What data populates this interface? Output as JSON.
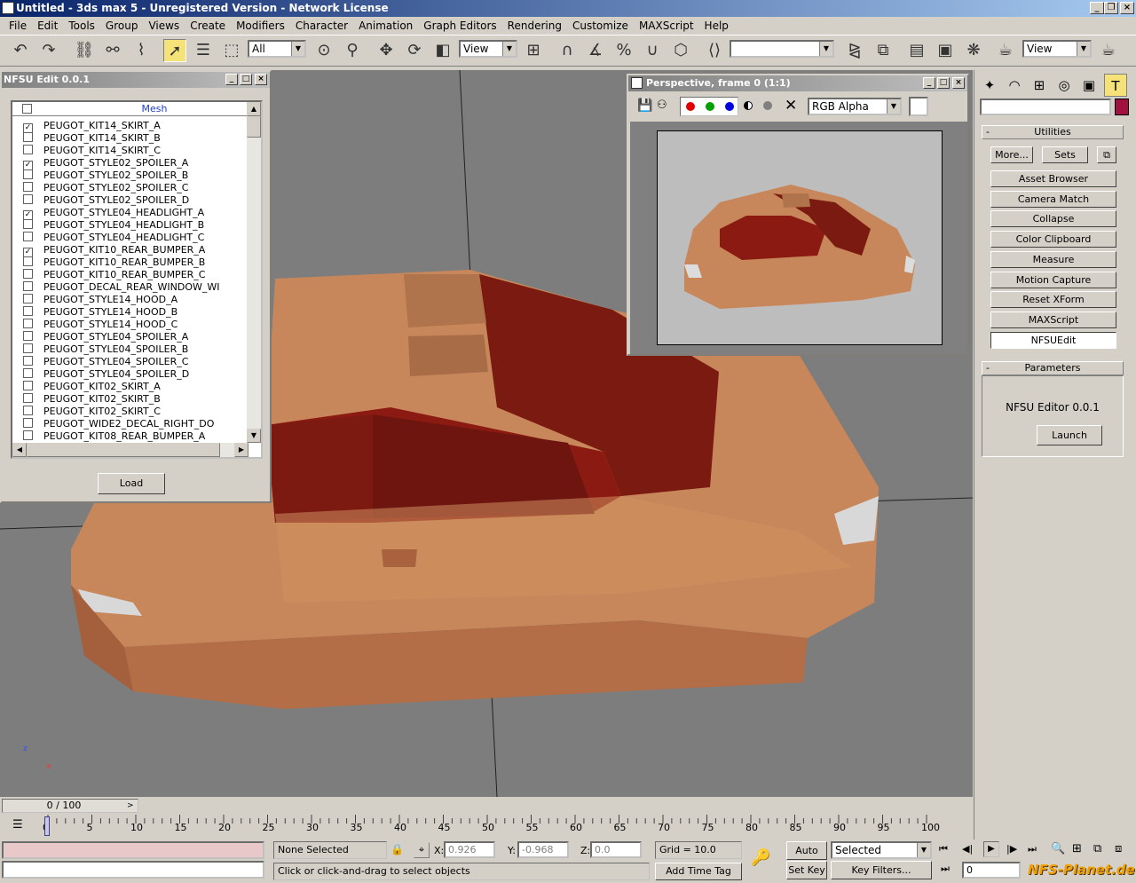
{
  "app": {
    "title": "Untitled - 3ds max 5 - Unregistered Version - Network License"
  },
  "menu": [
    "File",
    "Edit",
    "Tools",
    "Group",
    "Views",
    "Create",
    "Modifiers",
    "Character",
    "Animation",
    "Graph Editors",
    "Rendering",
    "Customize",
    "MAXScript",
    "Help"
  ],
  "toolbar": {
    "selection_filter": "All",
    "ref_coord": "View",
    "named_sel": "",
    "view_combo": "View"
  },
  "nfsu": {
    "title": "NFSU Edit 0.0.1",
    "column": "Mesh",
    "items": [
      {
        "label": "PEUGOT_KIT14_SKIRT_A",
        "checked": true
      },
      {
        "label": "PEUGOT_KIT14_SKIRT_B",
        "checked": false
      },
      {
        "label": "PEUGOT_KIT14_SKIRT_C",
        "checked": false
      },
      {
        "label": "PEUGOT_STYLE02_SPOILER_A",
        "checked": true
      },
      {
        "label": "PEUGOT_STYLE02_SPOILER_B",
        "checked": false
      },
      {
        "label": "PEUGOT_STYLE02_SPOILER_C",
        "checked": false
      },
      {
        "label": "PEUGOT_STYLE02_SPOILER_D",
        "checked": false
      },
      {
        "label": "PEUGOT_STYLE04_HEADLIGHT_A",
        "checked": true
      },
      {
        "label": "PEUGOT_STYLE04_HEADLIGHT_B",
        "checked": false
      },
      {
        "label": "PEUGOT_STYLE04_HEADLIGHT_C",
        "checked": false
      },
      {
        "label": "PEUGOT_KIT10_REAR_BUMPER_A",
        "checked": true
      },
      {
        "label": "PEUGOT_KIT10_REAR_BUMPER_B",
        "checked": false
      },
      {
        "label": "PEUGOT_KIT10_REAR_BUMPER_C",
        "checked": false
      },
      {
        "label": "PEUGOT_DECAL_REAR_WINDOW_WI",
        "checked": false
      },
      {
        "label": "PEUGOT_STYLE14_HOOD_A",
        "checked": false
      },
      {
        "label": "PEUGOT_STYLE14_HOOD_B",
        "checked": false
      },
      {
        "label": "PEUGOT_STYLE14_HOOD_C",
        "checked": false
      },
      {
        "label": "PEUGOT_STYLE04_SPOILER_A",
        "checked": false
      },
      {
        "label": "PEUGOT_STYLE04_SPOILER_B",
        "checked": false
      },
      {
        "label": "PEUGOT_STYLE04_SPOILER_C",
        "checked": false
      },
      {
        "label": "PEUGOT_STYLE04_SPOILER_D",
        "checked": false
      },
      {
        "label": "PEUGOT_KIT02_SKIRT_A",
        "checked": false
      },
      {
        "label": "PEUGOT_KIT02_SKIRT_B",
        "checked": false
      },
      {
        "label": "PEUGOT_KIT02_SKIRT_C",
        "checked": false
      },
      {
        "label": "PEUGOT_WIDE2_DECAL_RIGHT_DO",
        "checked": false
      },
      {
        "label": "PEUGOT_KIT08_REAR_BUMPER_A",
        "checked": false
      }
    ],
    "load_label": "Load"
  },
  "render": {
    "title": "Perspective, frame 0 (1:1)",
    "channel": "RGB Alpha"
  },
  "utilities": {
    "header": "Utilities",
    "more": "More...",
    "sets": "Sets",
    "buttons": [
      "Asset Browser",
      "Camera Match",
      "Collapse",
      "Color Clipboard",
      "Measure",
      "Motion Capture",
      "Reset XForm",
      "MAXScript",
      "NFSUEdit"
    ],
    "params_header": "Parameters",
    "editor_label": "NFSU Editor 0.0.1",
    "launch": "Launch",
    "minus": "-"
  },
  "timeline": {
    "frame": "0 / 100",
    "ticks": [
      "0",
      "5",
      "10",
      "15",
      "20",
      "25",
      "30",
      "35",
      "40",
      "45",
      "50",
      "55",
      "60",
      "65",
      "70",
      "75",
      "80",
      "85",
      "90",
      "95",
      "100"
    ]
  },
  "status": {
    "selection": "None Selected",
    "prompt": "Click or click-and-drag to select objects",
    "x_label": "X:",
    "x": "0.926",
    "y_label": "Y:",
    "y": "-0.968",
    "z_label": "Z:",
    "z": "0.0",
    "grid": "Grid = 10.0",
    "add_time_tag": "Add Time Tag",
    "auto_key": "Auto Key",
    "set_key": "Set Key",
    "key_mode": "Selected",
    "key_filters": "Key Filters...",
    "frame_field": "0",
    "watermark": "NFS-Planet.de"
  },
  "axis": {
    "z": "z",
    "x": "x"
  },
  "colors": {
    "accent": "#f5e37a",
    "car": "#c8875a",
    "glass": "#8b1a12"
  }
}
